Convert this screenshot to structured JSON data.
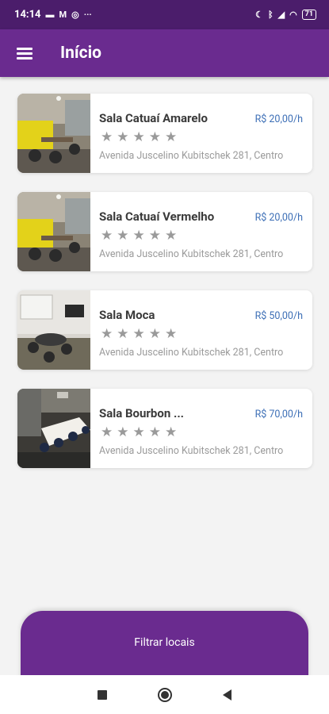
{
  "status_bar": {
    "time": "14:14",
    "battery": "71",
    "left_icons": [
      "message-icon",
      "gmail-icon",
      "whatsapp-icon",
      "more-icon"
    ],
    "right_icons": [
      "moon-icon",
      "bluetooth-icon",
      "signal-icon",
      "wifi-icon",
      "battery-icon"
    ]
  },
  "app_bar": {
    "title": "Início",
    "menu_icon": "hamburger-menu-icon",
    "background": "#6a2b8f"
  },
  "rooms": [
    {
      "name": "Sala Catuaí Amarelo",
      "price": "R$ 20,00/h",
      "stars": "★★★★★",
      "rating": 0,
      "address": "Avenida Juscelino Kubitschek 281, Centro"
    },
    {
      "name": "Sala Catuaí Vermelho",
      "price": "R$ 20,00/h",
      "stars": "★★★★★",
      "rating": 0,
      "address": "Avenida Juscelino Kubitschek 281, Centro"
    },
    {
      "name": "Sala Moca",
      "price": "R$ 50,00/h",
      "stars": "★★★★★",
      "rating": 0,
      "address": "Avenida Juscelino Kubitschek 281, Centro"
    },
    {
      "name": "Sala Bourbon ...",
      "price": "R$ 70,00/h",
      "stars": "★★★★★",
      "rating": 0,
      "address": "Avenida Juscelino Kubitschek 281, Centro"
    }
  ],
  "filter_button": {
    "label": "Filtrar locais"
  },
  "colors": {
    "primary": "#6a2b8f",
    "status_bar": "#4b1d6b",
    "price": "#3d6fb6",
    "muted": "#9a9a9a"
  }
}
